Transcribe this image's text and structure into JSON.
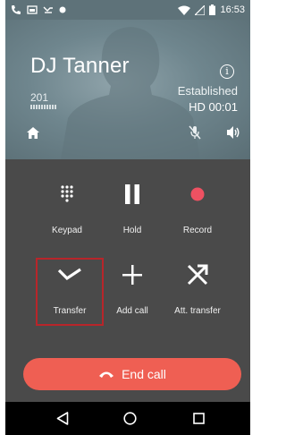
{
  "status_bar": {
    "time": "16:53",
    "icons": [
      "phone-call-icon",
      "voicemail-icon",
      "missed-call-icon",
      "dot-icon",
      "wifi-icon",
      "signal-icon",
      "battery-icon"
    ]
  },
  "header": {
    "caller_name": "DJ Tanner",
    "extension": "201",
    "call_state": "Established",
    "quality_timer": "HD  00:01"
  },
  "actions": {
    "keypad": "Keypad",
    "hold": "Hold",
    "record": "Record",
    "transfer": "Transfer",
    "add_call": "Add call",
    "att_transfer": "Att. transfer"
  },
  "end_call": {
    "label": "End call"
  },
  "colors": {
    "header_bg": "#6f868e",
    "body_bg": "#4a4a4a",
    "record_red": "#ef5162",
    "end_call": "#ef5f53",
    "highlight": "#b8252a"
  }
}
